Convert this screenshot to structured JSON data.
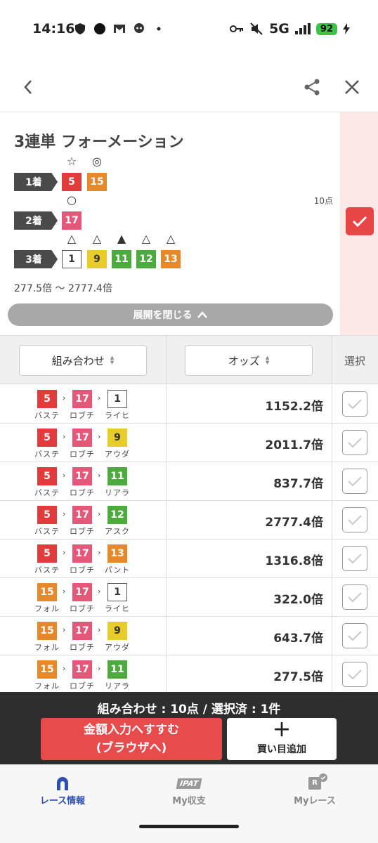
{
  "status": {
    "time": "14:16",
    "network": "5G",
    "battery": "92"
  },
  "panel": {
    "title": "3連単 フォーメーション",
    "points": "10点",
    "odds_range": "277.5倍 〜 2777.4倍",
    "collapse_label": "展開を閉じる",
    "ranks": [
      {
        "label": "1着",
        "horses": [
          {
            "num": "5",
            "color": "#e23b3b",
            "mark": "☆"
          },
          {
            "num": "15",
            "color": "#e6892a",
            "mark": "◎"
          }
        ]
      },
      {
        "label": "2着",
        "horses": [
          {
            "num": "17",
            "color": "#e5587a",
            "mark": "○"
          }
        ]
      },
      {
        "label": "3着",
        "horses": [
          {
            "num": "1",
            "color": "#ffffff",
            "mark": "△"
          },
          {
            "num": "9",
            "color": "#e8cc2a",
            "mark": "△"
          },
          {
            "num": "11",
            "color": "#4cab3c",
            "mark": "▲"
          },
          {
            "num": "12",
            "color": "#4cab3c",
            "mark": "△"
          },
          {
            "num": "13",
            "color": "#e6892a",
            "mark": "△"
          }
        ]
      }
    ]
  },
  "table": {
    "col_combo": "組み合わせ",
    "col_odds": "オッズ",
    "col_select": "選択",
    "rows": [
      {
        "h1": "5",
        "n1": "バステ",
        "h2": "17",
        "n2": "ロブチ",
        "h3": "1",
        "n3": "ライヒ",
        "odds": "1152.2倍"
      },
      {
        "h1": "5",
        "n1": "バステ",
        "h2": "17",
        "n2": "ロブチ",
        "h3": "9",
        "n3": "アウダ",
        "odds": "2011.7倍"
      },
      {
        "h1": "5",
        "n1": "バステ",
        "h2": "17",
        "n2": "ロブチ",
        "h3": "11",
        "n3": "リアラ",
        "odds": "837.7倍"
      },
      {
        "h1": "5",
        "n1": "バステ",
        "h2": "17",
        "n2": "ロブチ",
        "h3": "12",
        "n3": "アスク",
        "odds": "2777.4倍"
      },
      {
        "h1": "5",
        "n1": "バステ",
        "h2": "17",
        "n2": "ロブチ",
        "h3": "13",
        "n3": "パント",
        "odds": "1316.8倍"
      },
      {
        "h1": "15",
        "n1": "フォル",
        "h2": "17",
        "n2": "ロブチ",
        "h3": "1",
        "n3": "ライヒ",
        "odds": "322.0倍"
      },
      {
        "h1": "15",
        "n1": "フォル",
        "h2": "17",
        "n2": "ロブチ",
        "h3": "9",
        "n3": "アウダ",
        "odds": "643.7倍"
      },
      {
        "h1": "15",
        "n1": "フォル",
        "h2": "17",
        "n2": "ロブチ",
        "h3": "11",
        "n3": "リアラ",
        "odds": "277.5倍"
      }
    ]
  },
  "bottom": {
    "summary": "組み合わせ : 10点 / 選択済 : 1件",
    "go_line1": "金額入力へすすむ",
    "go_line2": "(ブラウザへ)",
    "add_label": "買い目追加"
  },
  "nav": {
    "items": [
      {
        "label": "レース情報",
        "icon": "horseshoe-icon"
      },
      {
        "label": "My収支",
        "icon": "ipat-icon",
        "icon_text": "IPAT"
      },
      {
        "label": "Myレース",
        "icon": "my-race-icon",
        "icon_text": "R"
      }
    ]
  },
  "colors": {
    "accent": "#e84b4b",
    "nav_active": "#2c4fb0",
    "side_pink": "#fde8e8"
  }
}
